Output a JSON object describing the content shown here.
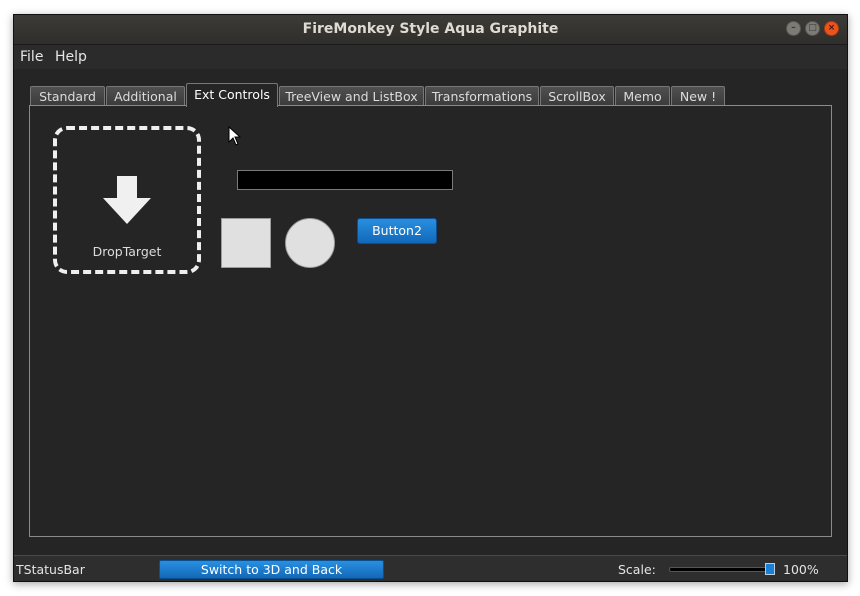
{
  "window": {
    "title": "FireMonkey Style Aqua Graphite"
  },
  "menu": {
    "items": [
      {
        "label": "File"
      },
      {
        "label": "Help"
      }
    ]
  },
  "tabs": [
    {
      "label": "Standard"
    },
    {
      "label": "Additional"
    },
    {
      "label": "Ext Controls",
      "active": true
    },
    {
      "label": "TreeView and ListBox"
    },
    {
      "label": "Transformations"
    },
    {
      "label": "ScrollBox"
    },
    {
      "label": "Memo"
    },
    {
      "label": "New !"
    }
  ],
  "content": {
    "droptarget_label": "DropTarget",
    "button2_label": "Button2"
  },
  "statusbar": {
    "label": "TStatusBar",
    "switch_button_label": "Switch to 3D and Back",
    "scale_label": "Scale:",
    "scale_value": "100%",
    "scale_fraction": 1.0
  },
  "icons": [
    "arrow-down-icon",
    "minimize-icon",
    "maximize-icon",
    "close-icon",
    "mouse-pointer-icon"
  ],
  "colors": {
    "accent": "#1a7fd6",
    "background": "#252525",
    "close_button": "#e9541f"
  }
}
